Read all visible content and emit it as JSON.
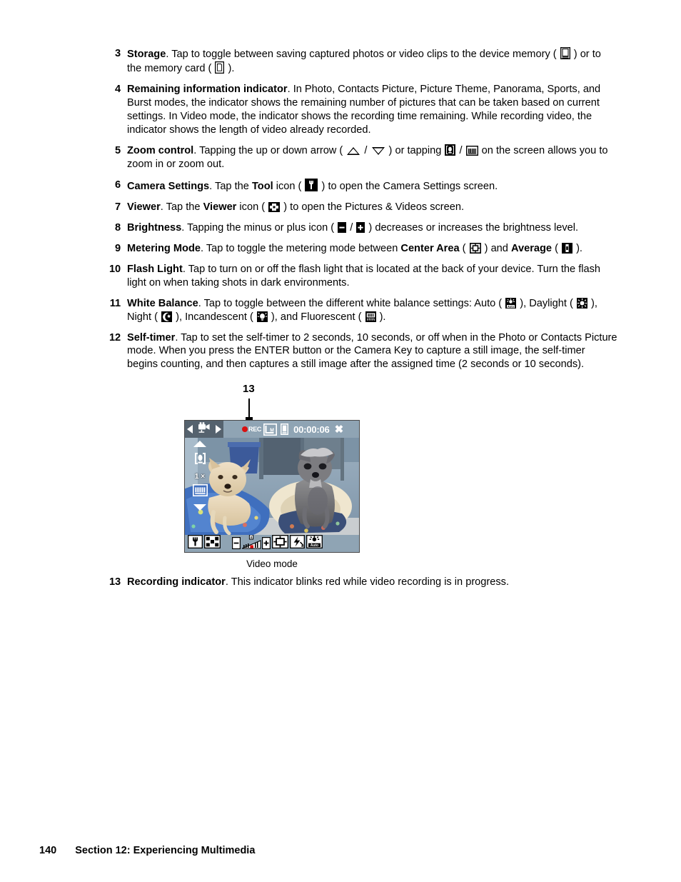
{
  "page": {
    "number": "140",
    "section": "Section 12: Experiencing Multimedia"
  },
  "items": [
    {
      "num": "3",
      "term": "Storage",
      "text_parts": [
        ". Tap to toggle between saving captured photos or video clips to the device memory ( ",
        " ) or to the memory card ( ",
        " )."
      ],
      "icons": [
        "device-memory-icon",
        "memory-card-icon"
      ]
    },
    {
      "num": "4",
      "term": "Remaining information indicator",
      "text": ". In Photo, Contacts Picture, Picture Theme, Panorama, Sports, and Burst modes, the indicator shows the remaining number of pictures that can be taken based on current settings. In Video mode, the indicator shows the recording time remaining. While recording video, the indicator shows the length of video already recorded."
    },
    {
      "num": "5",
      "term": "Zoom control",
      "text_parts": [
        ". Tapping the up or down arrow ( ",
        " / ",
        " ) or tapping ",
        " / ",
        " on the screen allows you to zoom in or zoom out."
      ],
      "icons": [
        "zoom-up-arrow-icon",
        "zoom-down-arrow-icon",
        "zoom-in-icon",
        "zoom-out-icon"
      ]
    },
    {
      "num": "6",
      "term": "Camera Settings",
      "text_parts": [
        ". Tap the ",
        "Tool",
        " icon ( ",
        " ) to open the Camera Settings screen."
      ],
      "icons": [
        "tool-wrench-icon"
      ]
    },
    {
      "num": "7",
      "term": "Viewer",
      "text_parts": [
        ". Tap the ",
        "Viewer",
        " icon ( ",
        " ) to open the Pictures & Videos screen."
      ],
      "icons": [
        "viewer-icon"
      ]
    },
    {
      "num": "8",
      "term": "Brightness",
      "text_parts": [
        ". Tapping the minus or plus icon ( ",
        " / ",
        " ) decreases or increases the brightness level."
      ],
      "icons": [
        "minus-icon",
        "plus-icon"
      ]
    },
    {
      "num": "9",
      "term": "Metering Mode",
      "text_parts": [
        ". Tap to toggle the metering mode between ",
        "Center Area",
        " ( ",
        " ) and ",
        "Average",
        " ( ",
        " )."
      ],
      "icons": [
        "center-area-metering-icon",
        "average-metering-icon"
      ]
    },
    {
      "num": "10",
      "term": "Flash Light",
      "text": ". Tap to turn on or off the flash light that is located at the back of your device. Turn the flash light on when taking shots in dark environments."
    },
    {
      "num": "11",
      "term": "White Balance",
      "text_parts": [
        ". Tap to toggle between the different white balance settings: Auto ( ",
        " ), Daylight ( ",
        " ), Night ( ",
        " ), Incandescent ( ",
        " ), and Fluorescent ( ",
        " )."
      ],
      "icons": [
        "wb-auto-icon",
        "wb-daylight-icon",
        "wb-night-icon",
        "wb-incandescent-icon",
        "wb-fluorescent-icon"
      ]
    },
    {
      "num": "12",
      "term": "Self-timer",
      "text": ". Tap to set the self-timer to 2 seconds, 10 seconds, or off when in the Photo or Contacts Picture mode. When you press the ENTER button or the Camera Key to capture a still image, the self-timer begins counting, and then captures a still image after the assigned time (2 seconds or 10 seconds)."
    }
  ],
  "figure": {
    "callout_label": "13",
    "caption": "Video mode",
    "device_screen": {
      "mode_prev_icon": "left-arrow-icon",
      "mode_icon": "video-camera-icon",
      "mode_next_icon": "right-arrow-icon",
      "rec_label": "REC",
      "quality_icon": "medium-quality-icon",
      "storage_icon": "device-memory-icon",
      "timer": "00:00:06",
      "close_icon": "close-icon",
      "zoom_up_icon": "zoom-up-arrow-icon",
      "zoom_in_icon": "zoom-in-icon",
      "zoom_level": "1",
      "zoom_level_unit": "×",
      "zoom_out_icon": "zoom-out-icon",
      "zoom_down_icon": "zoom-down-arrow-icon",
      "toolbar": {
        "tool_icon": "tool-wrench-icon",
        "viewer_icon": "viewer-icon",
        "minus_icon": "minus-icon",
        "brightness_icon": "brightness-slider-icon",
        "plus_icon": "plus-icon",
        "metering_icon": "center-area-metering-icon",
        "flash_icon": "flash-light-icon",
        "white_balance_icon": "wb-auto-icon"
      }
    }
  },
  "closing_item": {
    "num": "13",
    "term": "Recording indicator",
    "text": ". This indicator blinks red while video recording is in progress."
  },
  "colors": {
    "rec_red": "#d81010",
    "text": "#000000",
    "page_bg": "#ffffff"
  }
}
